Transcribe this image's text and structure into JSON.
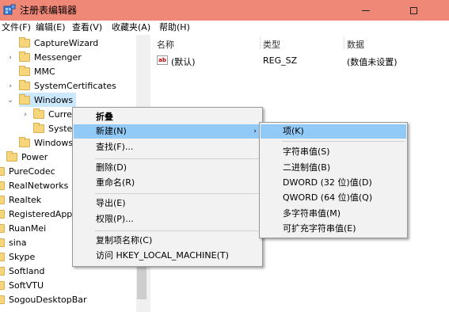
{
  "window": {
    "title": "注册表编辑器",
    "colors": {
      "titlebar": "#f08878",
      "highlight": "#91c9f7",
      "folder": "#f6d67d"
    }
  },
  "menubar": {
    "items": [
      "文件(F)",
      "编辑(E)",
      "查看(V)",
      "收藏夹(A)",
      "帮助(H)"
    ]
  },
  "tree": {
    "rows": [
      {
        "label": "CaptureWizard"
      },
      {
        "label": "Messenger"
      },
      {
        "label": "MMC"
      },
      {
        "label": "SystemCertificates"
      },
      {
        "label": "Windows"
      },
      {
        "label": "Curre"
      },
      {
        "label": "Syster"
      },
      {
        "label": "Windows"
      },
      {
        "label": "Power"
      },
      {
        "label": "PureCodec"
      },
      {
        "label": "RealNetworks"
      },
      {
        "label": "Realtek"
      },
      {
        "label": "RegisteredAppl"
      },
      {
        "label": "RuanMei"
      },
      {
        "label": "sina"
      },
      {
        "label": "Skype"
      },
      {
        "label": "Softland"
      },
      {
        "label": "SoftVTU"
      },
      {
        "label": "SogouDesktopBar"
      }
    ]
  },
  "values_pane": {
    "columns": [
      "名称",
      "类型",
      "数据"
    ],
    "rows": [
      {
        "name": "(默认)",
        "type": "REG_SZ",
        "data": "(数值未设置)",
        "icon": "ab-string-icon"
      }
    ]
  },
  "context_menu": {
    "items": [
      "折叠",
      "新建(N)",
      "查找(F)...",
      "删除(D)",
      "重命名(R)",
      "导出(E)",
      "权限(P)...",
      "复制项名称(C)",
      "访问 HKEY_LOCAL_MACHINE(T)"
    ]
  },
  "submenu": {
    "items": [
      "项(K)",
      "字符串值(S)",
      "二进制值(B)",
      "DWORD (32 位)值(D)",
      "QWORD (64 位)值(Q)",
      "多字符串值(M)",
      "可扩充字符串值(E)"
    ]
  }
}
